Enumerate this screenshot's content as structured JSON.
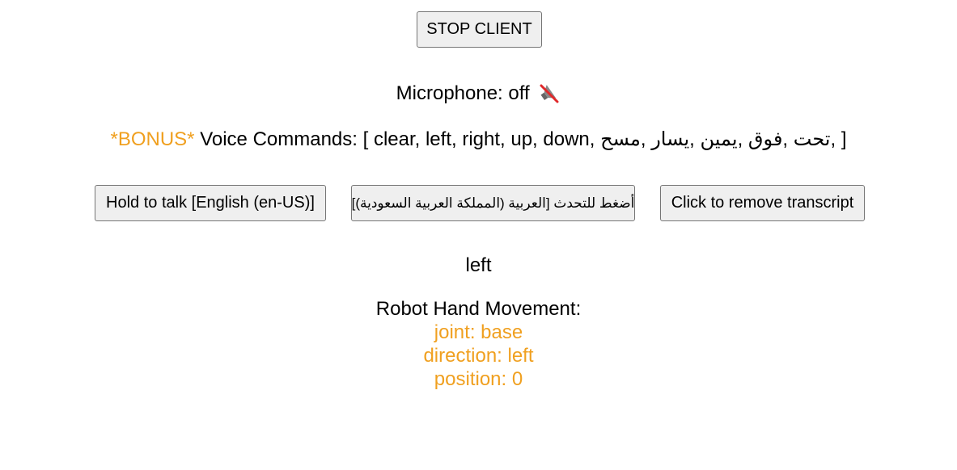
{
  "colors": {
    "accent": "#f0a020",
    "text": "#000000",
    "button_bg": "#efefef",
    "button_border": "#767676"
  },
  "controls": {
    "stop_label": "STOP CLIENT",
    "hold_en_label": "Hold to talk [English (en-US)]",
    "hold_ar_label": "أضغط للتحدث [العربية (المملكة العربية السعودية)]",
    "remove_label": "Click to remove transcript"
  },
  "microphone": {
    "text": "Microphone: off",
    "icon": "muted-speaker-icon"
  },
  "commands": {
    "bonus": "*BONUS*",
    "text": "Voice Commands: [ clear, left, right, up, down, تحت ,فوق ,يمين ,يسار ,مسح, ]"
  },
  "transcript": "left",
  "robot": {
    "title": "Robot Hand Movement:",
    "joint": "joint: base",
    "direction": "direction: left",
    "position": "position: 0"
  }
}
